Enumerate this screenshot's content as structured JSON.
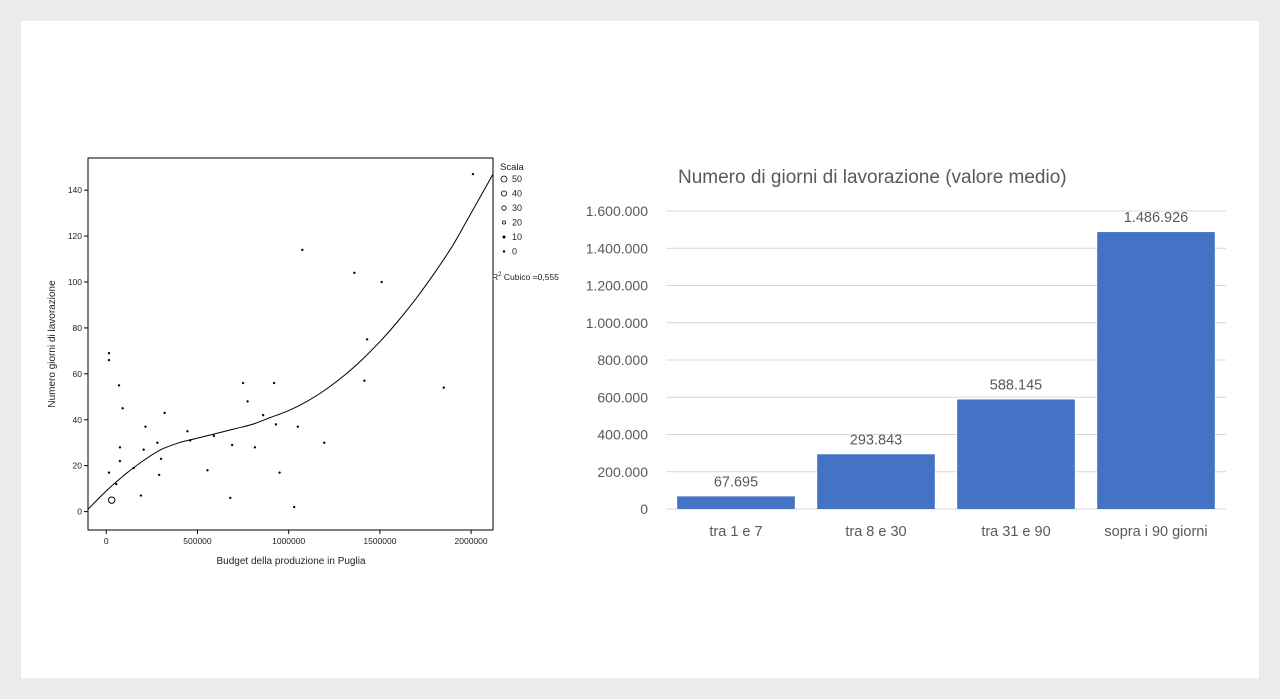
{
  "chart_data": [
    {
      "type": "scatter",
      "xlabel": "Budget della produzione in Puglia",
      "ylabel": "Numero giorni di lavorazione",
      "xlim": [
        -100000,
        2120000
      ],
      "ylim": [
        -8,
        154
      ],
      "x_ticks": [
        0,
        500000,
        1000000,
        1500000,
        2000000
      ],
      "x_tick_labels": [
        "0",
        "500000",
        "1000000",
        "1500000",
        "2000000"
      ],
      "y_ticks": [
        0,
        20,
        40,
        60,
        80,
        100,
        120,
        140
      ],
      "y_tick_labels": [
        "0",
        "20",
        "40",
        "60",
        "80",
        "100",
        "120",
        "140"
      ],
      "legend": {
        "title": "Scala",
        "placement": "right",
        "items": [
          "50",
          "40",
          "30",
          "20",
          "10",
          "0"
        ]
      },
      "fit_annotation": {
        "prefix": "R",
        "superscript": "2",
        "text": " Cubico =0,555"
      },
      "fit": {
        "type": "cubic",
        "x": [
          -100000,
          0,
          100000,
          200000,
          300000,
          400000,
          500000,
          600000,
          700000,
          800000,
          900000,
          1000000,
          1100000,
          1200000,
          1300000,
          1400000,
          1500000,
          1600000,
          1700000,
          1800000,
          1900000,
          2000000,
          2120000
        ],
        "y": [
          1,
          9,
          16,
          22,
          27,
          30,
          32,
          34,
          36,
          38,
          41,
          44,
          48,
          53,
          59,
          66,
          74,
          83,
          93,
          104,
          116,
          130,
          147
        ]
      },
      "points": [
        {
          "x": 15000,
          "y": 69,
          "size": 1
        },
        {
          "x": 15000,
          "y": 66,
          "size": 1
        },
        {
          "x": 15000,
          "y": 17,
          "size": 1
        },
        {
          "x": 30000,
          "y": 5,
          "size": 40
        },
        {
          "x": 55000,
          "y": 12,
          "size": 1
        },
        {
          "x": 70000,
          "y": 55,
          "size": 1
        },
        {
          "x": 75000,
          "y": 22,
          "size": 1
        },
        {
          "x": 75000,
          "y": 28,
          "size": 1
        },
        {
          "x": 90000,
          "y": 45,
          "size": 1
        },
        {
          "x": 150000,
          "y": 19,
          "size": 1
        },
        {
          "x": 190000,
          "y": 7,
          "size": 1
        },
        {
          "x": 205000,
          "y": 27,
          "size": 1
        },
        {
          "x": 215000,
          "y": 37,
          "size": 1
        },
        {
          "x": 280000,
          "y": 30,
          "size": 1
        },
        {
          "x": 290000,
          "y": 16,
          "size": 1
        },
        {
          "x": 300000,
          "y": 23,
          "size": 1
        },
        {
          "x": 320000,
          "y": 43,
          "size": 1
        },
        {
          "x": 445000,
          "y": 35,
          "size": 1
        },
        {
          "x": 460000,
          "y": 31,
          "size": 1
        },
        {
          "x": 555000,
          "y": 18,
          "size": 1
        },
        {
          "x": 590000,
          "y": 33,
          "size": 1
        },
        {
          "x": 680000,
          "y": 6,
          "size": 1
        },
        {
          "x": 690000,
          "y": 29,
          "size": 1
        },
        {
          "x": 750000,
          "y": 56,
          "size": 1
        },
        {
          "x": 775000,
          "y": 48,
          "size": 1
        },
        {
          "x": 815000,
          "y": 28,
          "size": 1
        },
        {
          "x": 860000,
          "y": 42,
          "size": 1
        },
        {
          "x": 920000,
          "y": 56,
          "size": 1
        },
        {
          "x": 930000,
          "y": 38,
          "size": 1
        },
        {
          "x": 950000,
          "y": 17,
          "size": 1
        },
        {
          "x": 1030000,
          "y": 2,
          "size": 1
        },
        {
          "x": 1050000,
          "y": 37,
          "size": 1
        },
        {
          "x": 1075000,
          "y": 114,
          "size": 1
        },
        {
          "x": 1195000,
          "y": 30,
          "size": 1
        },
        {
          "x": 1360000,
          "y": 104,
          "size": 1
        },
        {
          "x": 1415000,
          "y": 57,
          "size": 1
        },
        {
          "x": 1430000,
          "y": 75,
          "size": 1
        },
        {
          "x": 1510000,
          "y": 100,
          "size": 1
        },
        {
          "x": 1850000,
          "y": 54,
          "size": 1
        },
        {
          "x": 2010000,
          "y": 147,
          "size": 1
        }
      ]
    },
    {
      "type": "bar",
      "title": "Numero di giorni di lavorazione (valore medio)",
      "categories": [
        "tra 1 e 7",
        "tra 8 e 30",
        "tra 31 e 90",
        "sopra i 90 giorni"
      ],
      "values": [
        67695,
        293843,
        588145,
        1486926
      ],
      "value_labels": [
        "67.695",
        "293.843",
        "588.145",
        "1.486.926"
      ],
      "ylim": [
        0,
        1600000
      ],
      "y_ticks": [
        0,
        200000,
        400000,
        600000,
        800000,
        1000000,
        1200000,
        1400000,
        1600000
      ],
      "y_tick_labels": [
        "0",
        "200.000",
        "400.000",
        "600.000",
        "800.000",
        "1.000.000",
        "1.200.000",
        "1.400.000",
        "1.600.000"
      ],
      "grid": true,
      "colors": {
        "bar": "#4472c4",
        "grid": "#d9d9d9",
        "text": "#595959"
      }
    }
  ]
}
